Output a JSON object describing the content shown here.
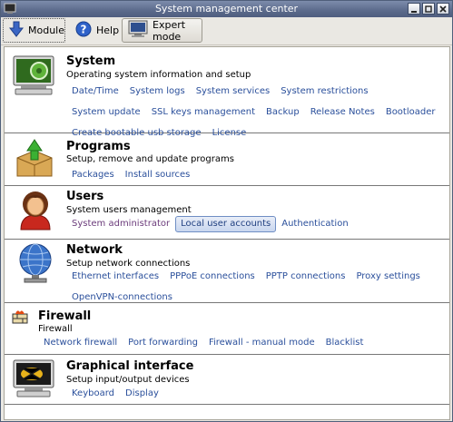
{
  "window": {
    "title": "System management center"
  },
  "toolbar": {
    "module_label": "Module",
    "help_label": "Help",
    "expert_label": "Expert mode"
  },
  "sections": [
    {
      "title": "System",
      "desc": "Operating system information and setup",
      "links": [
        "Date/Time",
        "System logs",
        "System services",
        "System restrictions",
        "System update",
        "SSL keys management",
        "Backup",
        "Release Notes",
        "Bootloader",
        "Create bootable usb storage",
        "License"
      ]
    },
    {
      "title": "Programs",
      "desc": "Setup, remove and update programs",
      "links": [
        "Packages",
        "Install sources"
      ]
    },
    {
      "title": "Users",
      "desc": "System users management",
      "links": [
        "System administrator",
        "Local user accounts",
        "Authentication"
      ]
    },
    {
      "title": "Network",
      "desc": "Setup network connections",
      "links": [
        "Ethernet interfaces",
        "PPPoE connections",
        "PPTP connections",
        "Proxy settings",
        "OpenVPN-connections"
      ]
    },
    {
      "title": "Firewall",
      "desc": "Firewall",
      "links": [
        "Network firewall",
        "Port forwarding",
        "Firewall - manual mode",
        "Blacklist"
      ]
    },
    {
      "title": "Graphical interface",
      "desc": "Setup input/output devices",
      "links": [
        "Keyboard",
        "Display"
      ]
    }
  ],
  "colors": {
    "link": "#2a4f9b",
    "visited": "#6b3b7b",
    "titlebar": "#5b6a8b"
  }
}
